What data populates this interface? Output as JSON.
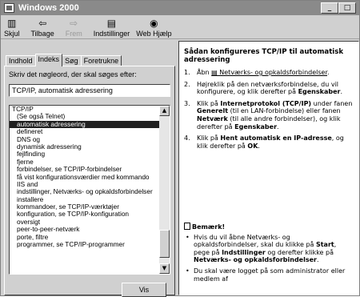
{
  "window": {
    "title": "Windows 2000",
    "controls": [
      "_",
      "□"
    ]
  },
  "toolbar": {
    "buttons": [
      {
        "icon": "▥",
        "label": "Skjul"
      },
      {
        "icon": "⇦",
        "label": "Tilbage"
      },
      {
        "icon": "⇨",
        "label": "Frem"
      },
      {
        "icon": "▤",
        "label": "Indstillinger"
      },
      {
        "icon": "◉",
        "label": "Web Hjælp"
      }
    ]
  },
  "tabs": [
    "Indhold",
    "Indeks",
    "Søg",
    "Foretrukne"
  ],
  "index": {
    "prompt": "Skriv det nøgleord, der skal søges efter:",
    "keyword": "TCP/IP, automatisk adressering",
    "items": [
      {
        "text": "TCP/IP",
        "indent": false,
        "selected": false
      },
      {
        "text": "(Se også Telnet)",
        "indent": true,
        "selected": false
      },
      {
        "text": "automatisk adressering",
        "indent": true,
        "selected": true
      },
      {
        "text": "defineret",
        "indent": true,
        "selected": false
      },
      {
        "text": "DNS og",
        "indent": true,
        "selected": false
      },
      {
        "text": "dynamisk adressering",
        "indent": true,
        "selected": false
      },
      {
        "text": "fejlfinding",
        "indent": true,
        "selected": false
      },
      {
        "text": "fjerne",
        "indent": true,
        "selected": false
      },
      {
        "text": "forbindelser, se TCP/IP-forbindelser",
        "indent": true,
        "selected": false
      },
      {
        "text": "få vist konfigurationsværdier med kommando",
        "indent": true,
        "selected": false
      },
      {
        "text": "IIS and",
        "indent": true,
        "selected": false
      },
      {
        "text": "indstillinger, Netværks- og opkaldsforbindelser",
        "indent": true,
        "selected": false
      },
      {
        "text": "installere",
        "indent": true,
        "selected": false
      },
      {
        "text": "kommandoer, se TCP/IP-værktøjer",
        "indent": true,
        "selected": false
      },
      {
        "text": "konfiguration, se TCP/IP-konfiguration",
        "indent": true,
        "selected": false
      },
      {
        "text": "oversigt",
        "indent": true,
        "selected": false
      },
      {
        "text": "peer-to-peer-netværk",
        "indent": true,
        "selected": false
      },
      {
        "text": "porte, filtre",
        "indent": true,
        "selected": false
      },
      {
        "text": "programmer, se TCP/IP-programmer",
        "indent": true,
        "selected": false
      }
    ],
    "show_button": "Vis"
  },
  "content": {
    "title": "Sådan konfigureres TCP/IP til automatisk adressering",
    "steps": [
      {
        "num": "1.",
        "parts": [
          {
            "t": "Åbn "
          },
          {
            "t": "▤ Netværks- og opkaldsforbindelser",
            "cls": "link"
          },
          {
            "t": "."
          }
        ]
      },
      {
        "num": "2.",
        "parts": [
          {
            "t": "Højreklik på den netværksforbindelse, du vil konfigurere, og klik derefter på "
          },
          {
            "t": "Egenskaber",
            "cls": "b"
          },
          {
            "t": "."
          }
        ]
      },
      {
        "num": "3.",
        "parts": [
          {
            "t": "Klik på "
          },
          {
            "t": "Internetprotokol (TCP/IP)",
            "cls": "b"
          },
          {
            "t": " under fanen "
          },
          {
            "t": "Generelt",
            "cls": "b"
          },
          {
            "t": " (til en LAN-forbindelse) eller fanen "
          },
          {
            "t": "Netværk",
            "cls": "b"
          },
          {
            "t": " (til alle andre forbindelser), og klik derefter på "
          },
          {
            "t": "Egenskaber",
            "cls": "b"
          },
          {
            "t": "."
          }
        ]
      },
      {
        "num": "4.",
        "parts": [
          {
            "t": "Klik på "
          },
          {
            "t": "Hent automatisk en IP-adresse",
            "cls": "b"
          },
          {
            "t": ", og klik derefter på "
          },
          {
            "t": "OK",
            "cls": "b"
          },
          {
            "t": "."
          }
        ]
      }
    ],
    "note_heading": "Bemærk!",
    "bullets": [
      {
        "parts": [
          {
            "t": "Hvis du vil åbne Netværks- og opkaldsforbindelser, skal du klikke på "
          },
          {
            "t": "Start",
            "cls": "b"
          },
          {
            "t": ", pege på "
          },
          {
            "t": "Indstillinger",
            "cls": "b"
          },
          {
            "t": " og derefter klikke på "
          },
          {
            "t": "Netværks- og opkaldsforbindelser",
            "cls": "b"
          },
          {
            "t": "."
          }
        ]
      },
      {
        "parts": [
          {
            "t": "Du skal være logget på som administrator eller medlem af"
          }
        ]
      }
    ]
  }
}
